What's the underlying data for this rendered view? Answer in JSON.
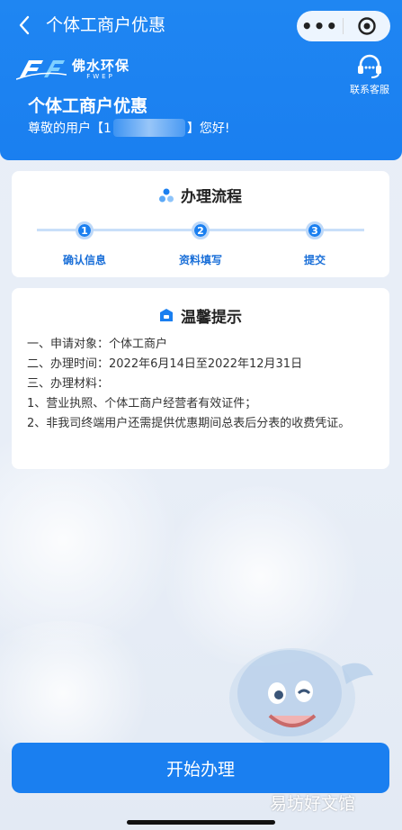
{
  "nav": {
    "title": "个体工商户优惠",
    "more_glyph": "•••"
  },
  "brand": {
    "name_cn": "佛水环保",
    "name_en": "FWEP"
  },
  "service": {
    "label": "联系客服"
  },
  "banner": {
    "title": "个体工商户优惠",
    "greeting_prefix": "尊敬的用户【1",
    "greeting_suffix": "】您好!"
  },
  "process": {
    "title": "办理流程",
    "steps": [
      {
        "number": "1",
        "label": "确认信息"
      },
      {
        "number": "2",
        "label": "资料填写"
      },
      {
        "number": "3",
        "label": "提交"
      }
    ]
  },
  "tips": {
    "title": "温馨提示",
    "lines": [
      "一、申请对象：个体工商户",
      "二、办理时间：2022年6月14日至2022年12月31日",
      "三、办理材料：",
      "1、营业执照、个体工商户经营者有效证件；",
      "2、非我司终端用户还需提供优惠期间总表后分表的收费凭证。"
    ]
  },
  "actions": {
    "start_label": "开始办理"
  },
  "watermark": "易坊好文馆",
  "colors": {
    "primary": "#1a7ff0",
    "step_label": "#1a6fd8",
    "background": "#eef1f6"
  }
}
